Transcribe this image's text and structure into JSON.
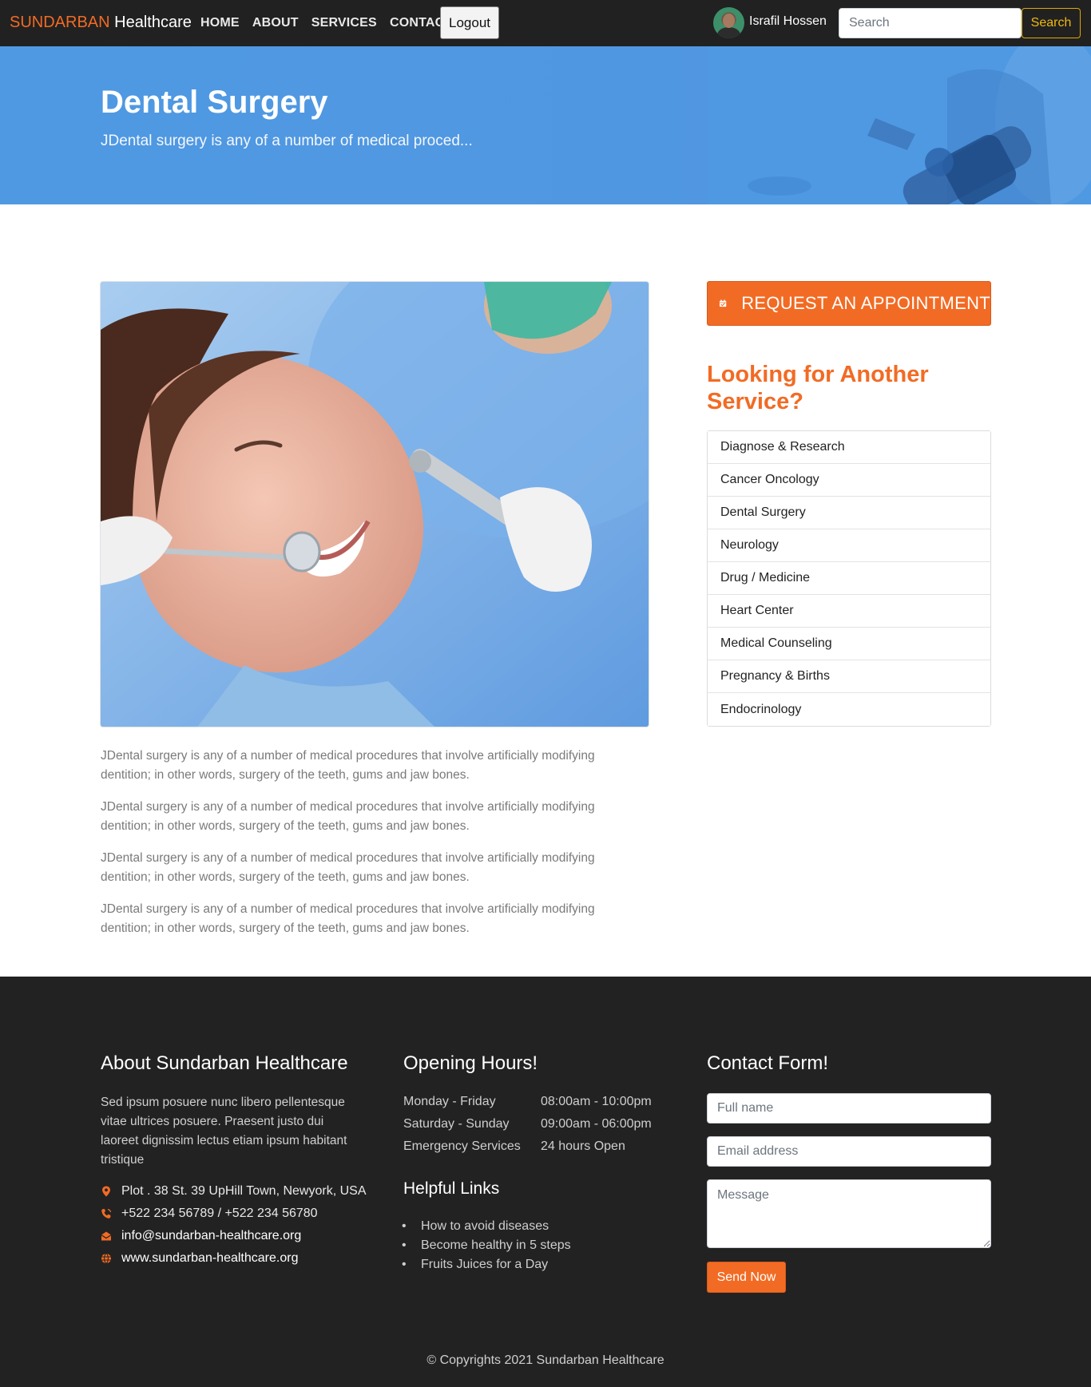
{
  "navbar": {
    "brand_accent": "SUNDARBAN",
    "brand_rest": "Healthcare",
    "links": [
      "HOME",
      "ABOUT",
      "SERVICES",
      "CONTACT"
    ],
    "logout_label": "Logout",
    "user_name": "Israfil Hossen",
    "search_placeholder": "Search",
    "search_button": "Search"
  },
  "hero": {
    "title": "Dental Surgery",
    "subtitle": "JDental surgery is any of a number of medical proced..."
  },
  "main": {
    "paragraphs": [
      "JDental surgery is any of a number of medical procedures that involve artificially modifying dentition; in other words, surgery of the teeth, gums and jaw bones.",
      "JDental surgery is any of a number of medical procedures that involve artificially modifying dentition; in other words, surgery of the teeth, gums and jaw bones.",
      "JDental surgery is any of a number of medical procedures that involve artificially modifying dentition; in other words, surgery of the teeth, gums and jaw bones.",
      "JDental surgery is any of a number of medical procedures that involve artificially modifying dentition; in other words, surgery of the teeth, gums and jaw bones."
    ]
  },
  "sidebar": {
    "appointment_label": "REQUEST AN APPOINTMENT",
    "heading": "Looking for Another Service?",
    "services": [
      "Diagnose & Research",
      "Cancer Oncology",
      "Dental Surgery",
      "Neurology",
      "Drug / Medicine",
      "Heart Center",
      "Medical Counseling",
      "Pregnancy & Births",
      "Endocrinology"
    ]
  },
  "footer": {
    "about_heading": "About Sundarban Healthcare",
    "about_text": "Sed ipsum posuere nunc libero pellentesque vitae ultrices posuere. Praesent justo dui laoreet dignissim lectus etiam ipsum habitant tristique",
    "address": "Plot . 38 St. 39 UpHill Town, Newyork, USA",
    "phone": "+522 234 56789 / +522 234 56780",
    "email": "info@sundarban-healthcare.org",
    "website": "www.sundarban-healthcare.org",
    "hours_heading": "Opening Hours!",
    "hours": [
      {
        "day": "Monday - Friday",
        "time": "08:00am - 10:00pm"
      },
      {
        "day": "Saturday - Sunday",
        "time": "09:00am - 06:00pm"
      },
      {
        "day": "Emergency Services",
        "time": "24 hours Open"
      }
    ],
    "links_heading": "Helpful Links",
    "links": [
      "How to avoid diseases",
      "Become healthy in 5 steps",
      "Fruits Juices for a Day"
    ],
    "form_heading": "Contact Form!",
    "name_placeholder": "Full name",
    "email_placeholder": "Email address",
    "message_placeholder": "Message",
    "send_label": "Send Now",
    "copyright": "© Copyrights 2021 Sundarban Healthcare"
  },
  "colors": {
    "accent": "#f26b24",
    "navbar_bg": "#212121",
    "hero_bg": "#4f99e3",
    "footer_bg": "#222222",
    "search_outline": "#e0a800"
  },
  "icons": [
    "calendar-check-icon",
    "map-marker-icon",
    "phone-icon",
    "envelope-icon",
    "globe-icon"
  ]
}
